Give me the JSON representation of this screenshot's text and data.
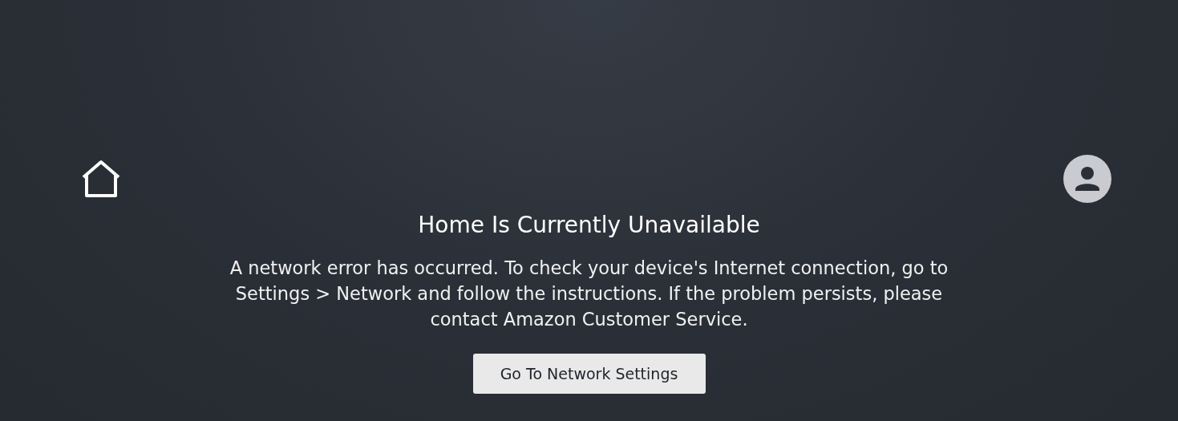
{
  "title": "Home Is Currently Unavailable",
  "message": "A network error has occurred. To check your device's Internet connection, go to Settings > Network and follow the instructions. If the problem persists, please contact Amazon Customer Service.",
  "button": {
    "label": "Go To Network Settings"
  }
}
